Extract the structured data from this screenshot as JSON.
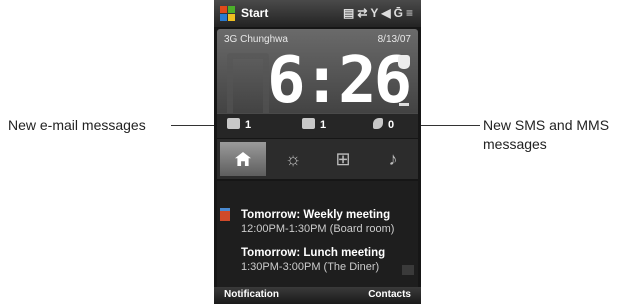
{
  "callouts": {
    "email": "New e-mail messages",
    "sms": "New SMS and MMS messages"
  },
  "statusbar": {
    "start_label": "Start",
    "icons": [
      "contacts-icon",
      "sync-icon",
      "signal-icon",
      "volume-icon",
      "battery-icon",
      "menu-icon"
    ]
  },
  "clock": {
    "operator": "3G Chunghwa",
    "date": "8/13/07",
    "time": "6:26"
  },
  "notifications": {
    "email_count": "1",
    "sms_count": "1",
    "missed_calls": "0"
  },
  "tabs": [
    {
      "icon": "home-icon",
      "active": true
    },
    {
      "icon": "weather-icon",
      "active": false
    },
    {
      "icon": "programs-icon",
      "active": false
    },
    {
      "icon": "music-icon",
      "active": false
    }
  ],
  "appointments": [
    {
      "title": "Tomorrow: Weekly meeting",
      "time": "12:00PM-1:30PM (Board room)"
    },
    {
      "title": "Tomorrow: Lunch meeting",
      "time": "1:30PM-3:00PM (The Diner)"
    }
  ],
  "softkeys": {
    "left": "Notification",
    "right": "Contacts"
  },
  "colors": {
    "flag_red": "#e04a1a",
    "flag_green": "#4caf2a",
    "flag_blue": "#2a7ad0",
    "flag_yellow": "#f0c020"
  }
}
